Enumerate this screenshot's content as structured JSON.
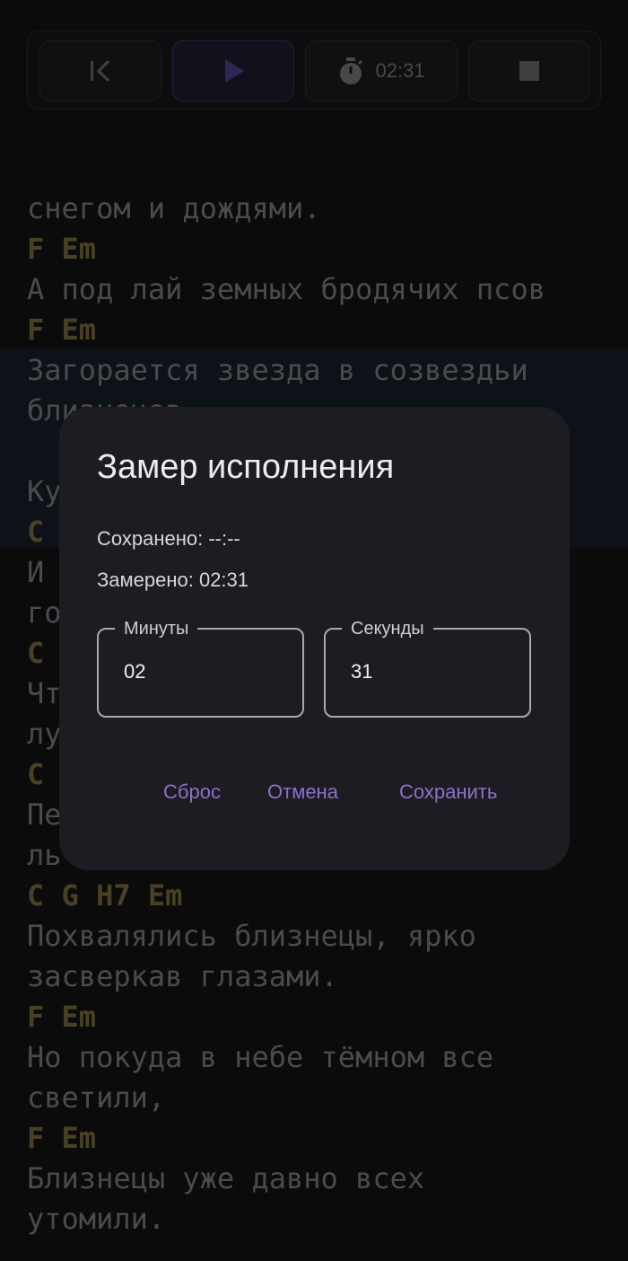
{
  "toolbar": {
    "buttons": [
      {
        "name": "skip-start",
        "icon": "skip-start-icon"
      },
      {
        "name": "play",
        "icon": "play-icon"
      },
      {
        "name": "timer",
        "icon": "stopwatch-icon",
        "label": "02:31"
      },
      {
        "name": "stop",
        "icon": "stop-icon"
      }
    ]
  },
  "lyrics": {
    "lines": [
      {
        "type": "lyric",
        "text": "снегом и дождями."
      },
      {
        "type": "chord",
        "text": "F Em"
      },
      {
        "type": "lyric",
        "text": "А под лай земных бродячих псов"
      },
      {
        "type": "chord",
        "text": "F Em"
      },
      {
        "type": "lyric",
        "text": "Загорается звезда в созвездьи"
      },
      {
        "type": "lyric",
        "text": "близнецов."
      },
      {
        "type": "blank",
        "text": ""
      },
      {
        "type": "lyric",
        "text": "Ку"
      },
      {
        "type": "chord",
        "text": "C"
      },
      {
        "type": "lyric",
        "text": "И"
      },
      {
        "type": "lyric",
        "text": "го"
      },
      {
        "type": "chord",
        "text": "C"
      },
      {
        "type": "lyric",
        "text": "Чт"
      },
      {
        "type": "lyric",
        "text": "лу"
      },
      {
        "type": "chord",
        "text": "C"
      },
      {
        "type": "lyric",
        "text": "Пе"
      },
      {
        "type": "lyric",
        "text": "ль"
      },
      {
        "type": "chord",
        "text": "C G H7 Em"
      },
      {
        "type": "lyric",
        "text": "Похвалялись близнецы, ярко"
      },
      {
        "type": "lyric",
        "text": "засверкав глазами."
      },
      {
        "type": "chord",
        "text": "F Em"
      },
      {
        "type": "lyric",
        "text": "Но покуда в небе тёмном все"
      },
      {
        "type": "lyric",
        "text": "светили,"
      },
      {
        "type": "chord",
        "text": "F Em"
      },
      {
        "type": "lyric",
        "text": "Близнецы уже давно всех"
      },
      {
        "type": "lyric",
        "text": "утомили."
      }
    ]
  },
  "dialog": {
    "title": "Замер исполнения",
    "saved": "Сохранено: --:--",
    "measured": "Замерено: 02:31",
    "minutes": {
      "label": "Минуты",
      "value": "02"
    },
    "seconds": {
      "label": "Секунды",
      "value": "31"
    },
    "buttons": {
      "reset": "Сброс",
      "cancel": "Отмена",
      "save": "Сохранить"
    }
  },
  "colors": {
    "accent": "#8a72c8",
    "chord": "#78693d",
    "lyric": "#79797d",
    "highlight": "#151d29",
    "dialog_bg": "#1e1c23"
  }
}
